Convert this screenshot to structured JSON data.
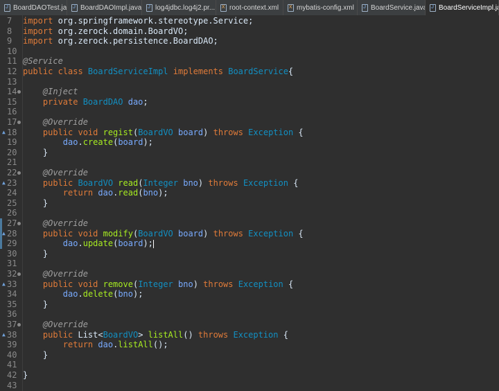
{
  "tabs": [
    {
      "label": "BoardDAOTest.java",
      "icon": "java-file-icon"
    },
    {
      "label": "BoardDAOImpl.java",
      "icon": "java-file-icon"
    },
    {
      "label": "log4jdbc.log4j2.pr...",
      "icon": "java-file-icon"
    },
    {
      "label": "root-context.xml",
      "icon": "xml-file-icon"
    },
    {
      "label": "mybatis-config.xml",
      "icon": "xml-file-icon"
    },
    {
      "label": "BoardService.java",
      "icon": "java-file-icon"
    },
    {
      "label": "BoardServiceImpl.ja...",
      "icon": "java-file-icon",
      "active": true
    }
  ],
  "lines": [
    {
      "n": "7",
      "code": [
        [
          "kw",
          "import"
        ],
        [
          "plain",
          " org.springframework.stereotype.Service;"
        ]
      ]
    },
    {
      "n": "8",
      "code": [
        [
          "kw",
          "import"
        ],
        [
          "plain",
          " org.zerock.domain.BoardVO;"
        ]
      ]
    },
    {
      "n": "9",
      "code": [
        [
          "kw",
          "import"
        ],
        [
          "plain",
          " org.zerock.persistence.BoardDAO;"
        ]
      ]
    },
    {
      "n": "10",
      "code": []
    },
    {
      "n": "11",
      "code": [
        [
          "ann",
          "@Service"
        ]
      ]
    },
    {
      "n": "12",
      "code": [
        [
          "kw",
          "public class "
        ],
        [
          "type",
          "BoardServiceImpl"
        ],
        [
          "kw",
          " implements "
        ],
        [
          "type",
          "BoardService"
        ],
        [
          "plain",
          "{"
        ]
      ]
    },
    {
      "n": "13",
      "code": []
    },
    {
      "n": "14",
      "dot": true,
      "code": [
        [
          "plain",
          "    "
        ],
        [
          "ann",
          "@Inject"
        ]
      ]
    },
    {
      "n": "15",
      "code": [
        [
          "plain",
          "    "
        ],
        [
          "kw",
          "private "
        ],
        [
          "type",
          "BoardDAO"
        ],
        [
          "var",
          " dao"
        ],
        [
          "plain",
          ";"
        ]
      ]
    },
    {
      "n": "16",
      "code": []
    },
    {
      "n": "17",
      "dot": true,
      "code": [
        [
          "plain",
          "    "
        ],
        [
          "ann",
          "@Override"
        ]
      ]
    },
    {
      "n": "18",
      "mark": true,
      "code": [
        [
          "plain",
          "    "
        ],
        [
          "kw",
          "public void "
        ],
        [
          "meth",
          "regist"
        ],
        [
          "plain",
          "("
        ],
        [
          "type",
          "BoardVO"
        ],
        [
          "var",
          " board"
        ],
        [
          "plain",
          ") "
        ],
        [
          "kw",
          "throws "
        ],
        [
          "type",
          "Exception"
        ],
        [
          "plain",
          " {"
        ]
      ]
    },
    {
      "n": "19",
      "code": [
        [
          "plain",
          "        "
        ],
        [
          "var",
          "dao"
        ],
        [
          "plain",
          "."
        ],
        [
          "meth",
          "create"
        ],
        [
          "plain",
          "("
        ],
        [
          "var",
          "board"
        ],
        [
          "plain",
          ");"
        ]
      ]
    },
    {
      "n": "20",
      "code": [
        [
          "plain",
          "    }"
        ]
      ]
    },
    {
      "n": "21",
      "code": []
    },
    {
      "n": "22",
      "dot": true,
      "code": [
        [
          "plain",
          "    "
        ],
        [
          "ann",
          "@Override"
        ]
      ]
    },
    {
      "n": "23",
      "mark": true,
      "code": [
        [
          "plain",
          "    "
        ],
        [
          "kw",
          "public "
        ],
        [
          "type",
          "BoardVO"
        ],
        [
          "meth",
          " read"
        ],
        [
          "plain",
          "("
        ],
        [
          "type",
          "Integer"
        ],
        [
          "var",
          " bno"
        ],
        [
          "plain",
          ") "
        ],
        [
          "kw",
          "throws "
        ],
        [
          "type",
          "Exception"
        ],
        [
          "plain",
          " {"
        ]
      ]
    },
    {
      "n": "24",
      "code": [
        [
          "plain",
          "        "
        ],
        [
          "kw",
          "return "
        ],
        [
          "var",
          "dao"
        ],
        [
          "plain",
          "."
        ],
        [
          "meth",
          "read"
        ],
        [
          "plain",
          "("
        ],
        [
          "var",
          "bno"
        ],
        [
          "plain",
          ");"
        ]
      ]
    },
    {
      "n": "25",
      "code": [
        [
          "plain",
          "    }"
        ]
      ]
    },
    {
      "n": "26",
      "code": []
    },
    {
      "n": "27",
      "dot": true,
      "changed": true,
      "code": [
        [
          "plain",
          "    "
        ],
        [
          "ann",
          "@Override"
        ]
      ]
    },
    {
      "n": "28",
      "mark": true,
      "changed": true,
      "code": [
        [
          "plain",
          "    "
        ],
        [
          "kw",
          "public void "
        ],
        [
          "meth",
          "modify"
        ],
        [
          "plain",
          "("
        ],
        [
          "type",
          "BoardVO"
        ],
        [
          "var",
          " board"
        ],
        [
          "plain",
          ") "
        ],
        [
          "kw",
          "throws "
        ],
        [
          "type",
          "Exception"
        ],
        [
          "plain",
          " {"
        ]
      ]
    },
    {
      "n": "29",
      "changed": true,
      "current": true,
      "code": [
        [
          "plain",
          "        "
        ],
        [
          "var",
          "dao"
        ],
        [
          "plain",
          "."
        ],
        [
          "meth",
          "update"
        ],
        [
          "plain",
          "("
        ],
        [
          "var",
          "board"
        ],
        [
          "plain",
          ");"
        ]
      ]
    },
    {
      "n": "30",
      "code": [
        [
          "plain",
          "    }"
        ]
      ]
    },
    {
      "n": "31",
      "code": []
    },
    {
      "n": "32",
      "dot": true,
      "code": [
        [
          "plain",
          "    "
        ],
        [
          "ann",
          "@Override"
        ]
      ]
    },
    {
      "n": "33",
      "mark": true,
      "code": [
        [
          "plain",
          "    "
        ],
        [
          "kw",
          "public void "
        ],
        [
          "meth",
          "remove"
        ],
        [
          "plain",
          "("
        ],
        [
          "type",
          "Integer"
        ],
        [
          "var",
          " bno"
        ],
        [
          "plain",
          ") "
        ],
        [
          "kw",
          "throws "
        ],
        [
          "type",
          "Exception"
        ],
        [
          "plain",
          " {"
        ]
      ]
    },
    {
      "n": "34",
      "code": [
        [
          "plain",
          "        "
        ],
        [
          "var",
          "dao"
        ],
        [
          "plain",
          "."
        ],
        [
          "meth",
          "delete"
        ],
        [
          "plain",
          "("
        ],
        [
          "var",
          "bno"
        ],
        [
          "plain",
          ");"
        ]
      ]
    },
    {
      "n": "35",
      "code": [
        [
          "plain",
          "    }"
        ]
      ]
    },
    {
      "n": "36",
      "code": []
    },
    {
      "n": "37",
      "dot": true,
      "code": [
        [
          "plain",
          "    "
        ],
        [
          "ann",
          "@Override"
        ]
      ]
    },
    {
      "n": "38",
      "mark": true,
      "code": [
        [
          "plain",
          "    "
        ],
        [
          "kw",
          "public "
        ],
        [
          "plain",
          "List<"
        ],
        [
          "type",
          "BoardVO"
        ],
        [
          "plain",
          "> "
        ],
        [
          "meth",
          "listAll"
        ],
        [
          "plain",
          "() "
        ],
        [
          "kw",
          "throws "
        ],
        [
          "type",
          "Exception"
        ],
        [
          "plain",
          " {"
        ]
      ]
    },
    {
      "n": "39",
      "code": [
        [
          "plain",
          "        "
        ],
        [
          "kw",
          "return "
        ],
        [
          "var",
          "dao"
        ],
        [
          "plain",
          "."
        ],
        [
          "meth",
          "listAll"
        ],
        [
          "plain",
          "();"
        ]
      ]
    },
    {
      "n": "40",
      "code": [
        [
          "plain",
          "    }"
        ]
      ]
    },
    {
      "n": "41",
      "code": []
    },
    {
      "n": "42",
      "code": [
        [
          "plain",
          "}"
        ]
      ]
    },
    {
      "n": "43",
      "code": []
    }
  ]
}
